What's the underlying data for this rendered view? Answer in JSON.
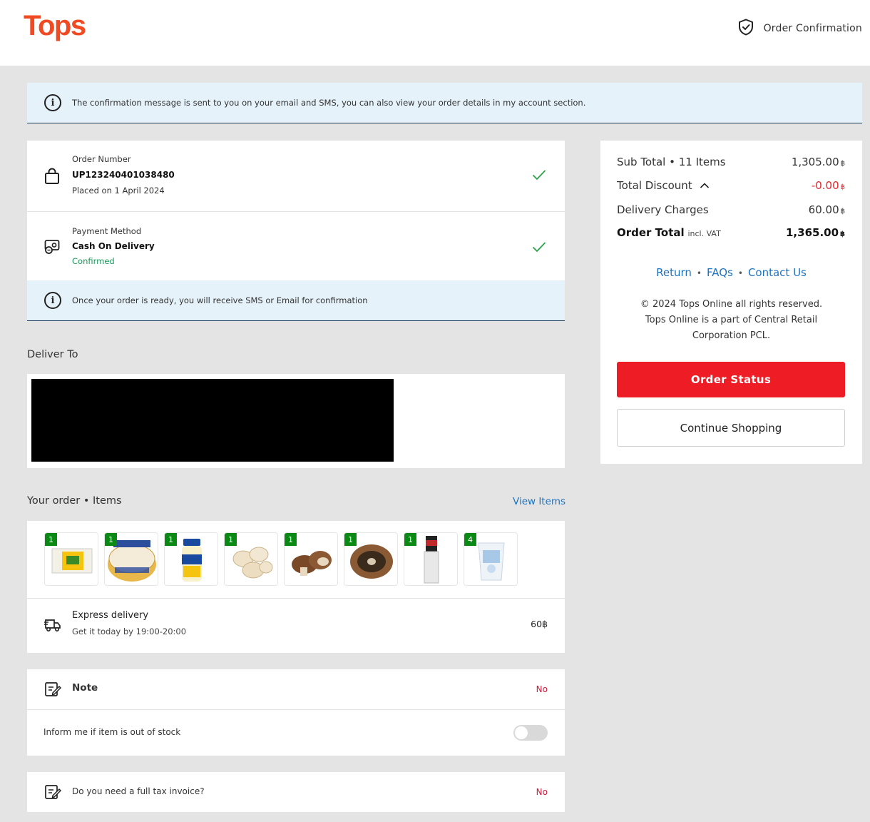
{
  "header": {
    "logo": "Tops",
    "page_label": "Order Confirmation"
  },
  "banner": {
    "text": "The confirmation message is sent to you on your email and SMS, you can also view your order details in my account section."
  },
  "order": {
    "number_label": "Order Number",
    "number": "UP123240401038480",
    "placed": "Placed on 1 April 2024"
  },
  "payment": {
    "label": "Payment Method",
    "method": "Cash On Delivery",
    "status": "Confirmed",
    "status_color": "#1a9a5a"
  },
  "ready_note": "Once your order is ready, you will receive SMS or Email for confirmation",
  "deliver_to": {
    "title": "Deliver To"
  },
  "items": {
    "title": "Your order • Items",
    "view_link": "View Items",
    "products": [
      {
        "qty": "1",
        "icon": "cheese-block"
      },
      {
        "qty": "1",
        "icon": "camembert-tin"
      },
      {
        "qty": "1",
        "icon": "mayonnaise-jar"
      },
      {
        "qty": "1",
        "icon": "white-mushrooms"
      },
      {
        "qty": "1",
        "icon": "brown-mushrooms"
      },
      {
        "qty": "1",
        "icon": "portobello-mushroom"
      },
      {
        "qty": "1",
        "icon": "spice-grinder"
      },
      {
        "qty": "4",
        "icon": "yogurt-cup"
      }
    ],
    "delivery_title": "Express delivery",
    "delivery_sub": "Get it today by 19:00-20:00",
    "delivery_price": "60฿"
  },
  "note": {
    "title": "Note",
    "value": "No",
    "stock_label": "Inform me if item is out of stock",
    "stock_toggle": false
  },
  "tax": {
    "label": "Do you need a full tax invoice?",
    "value": "No"
  },
  "summary": {
    "subtotal_label": "Sub Total • 11 Items",
    "subtotal": "1,305.00",
    "discount_label": "Total Discount",
    "discount": "-0.00",
    "delivery_label": "Delivery Charges",
    "delivery": "60.00",
    "total_label": "Order Total",
    "total_vat": "incl. VAT",
    "total": "1,365.00",
    "currency": "฿",
    "link_return": "Return",
    "link_faqs": "FAQs",
    "link_contact": "Contact Us",
    "copyright": "© 2024 Tops Online all rights reserved. Tops Online is a part of Central Retail Corporation PCL.",
    "btn_status": "Order Status",
    "btn_continue": "Continue Shopping"
  },
  "colors": {
    "brand": "#f04a23",
    "primary_button": "#ee1c25",
    "link": "#1e73be",
    "qty_badge": "#0a8a14",
    "no_value": "#d01c3b"
  }
}
